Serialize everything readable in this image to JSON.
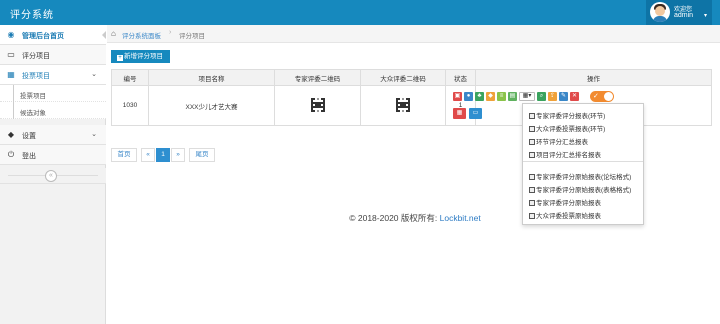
{
  "app": {
    "title": "评分系统"
  },
  "user": {
    "greeting": "欢迎您",
    "name": "admin"
  },
  "sidebar": {
    "items": [
      {
        "label": "管理后台首页",
        "icon": "dashboard-icon"
      },
      {
        "label": "评分项目",
        "icon": "monitor-icon"
      },
      {
        "label": "投票项目",
        "icon": "chart-icon"
      },
      {
        "label": "设置",
        "icon": "tag-icon"
      },
      {
        "label": "登出",
        "icon": "power-icon"
      }
    ],
    "subitems": [
      {
        "label": "投票项目"
      },
      {
        "label": "候选对象"
      }
    ]
  },
  "breadcrumb": {
    "home": "评分系统面板",
    "current": "评分项目"
  },
  "toolbar": {
    "add_label": "新增评分项目"
  },
  "table": {
    "headers": [
      "编号",
      "项目名称",
      "专家评委二维码",
      "大众评委二维码",
      "状态",
      "操作"
    ],
    "rows": [
      {
        "id": "1030",
        "name": "XXX少儿才艺大赛",
        "status": "1"
      }
    ]
  },
  "dropdown": {
    "group1": [
      "专家评委评分报表(环节)",
      "大众评委投票报表(环节)",
      "环节评分汇总报表",
      "项目评分汇总排名报表"
    ],
    "group2": [
      "专家评委评分原始报表(论坛格式)",
      "专家评委评分原始报表(表格格式)",
      "专家评委评分原始报表",
      "大众评委投票原始报表"
    ]
  },
  "pager": {
    "first": "首页",
    "prev": "«",
    "current": "1",
    "next": "»",
    "last": "尾页"
  },
  "footer": {
    "copyright": "© 2018-2020 版权所有:",
    "link": "Lockbit.net"
  },
  "colors": {
    "header": "#1689be",
    "toggle": "#f28b30",
    "link": "#3a87c8"
  }
}
